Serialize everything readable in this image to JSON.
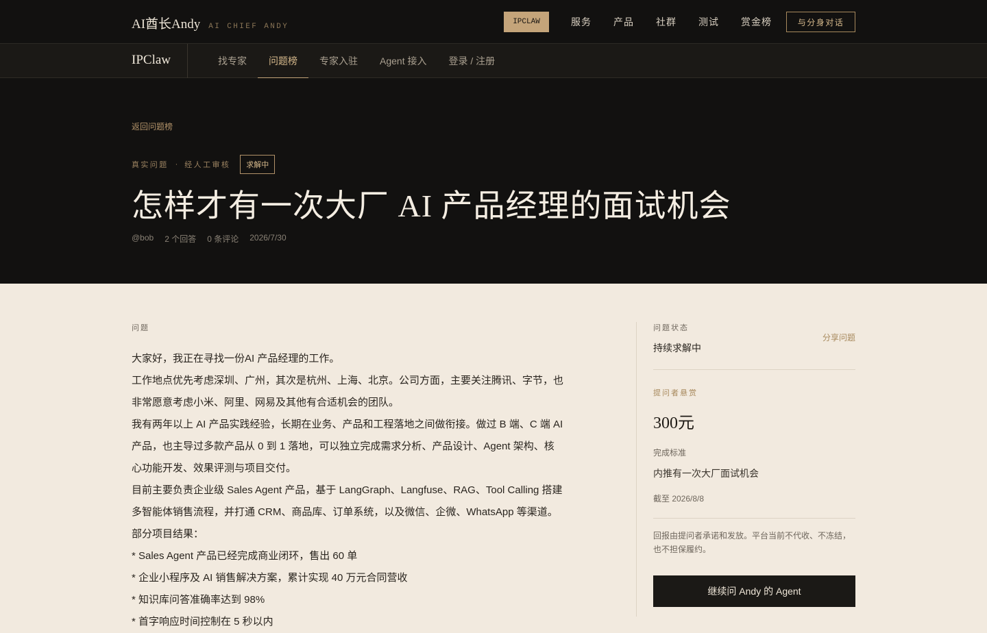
{
  "topbar": {
    "brand_name": "AI酋长Andy",
    "brand_sub": "AI CHIEF ANDY",
    "ipclaw_label": "IPCLAW",
    "nav": [
      "服务",
      "产品",
      "社群",
      "测试",
      "赏金榜"
    ],
    "cta_label": "与分身对话"
  },
  "subbar": {
    "brand": "IPClaw",
    "tabs": [
      {
        "label": "找专家",
        "active": false
      },
      {
        "label": "问题榜",
        "active": true
      },
      {
        "label": "专家入驻",
        "active": false
      },
      {
        "label": "Agent 接入",
        "active": false
      },
      {
        "label": "登录 / 注册",
        "active": false
      }
    ]
  },
  "hero": {
    "back_link": "返回问题榜",
    "tag_real": "真实问题",
    "tag_dot": "·",
    "tag_review": "经人工审核",
    "badge": "求解中",
    "title": "怎样才有一次大厂 AI 产品经理的面试机会",
    "author": "@bob",
    "answers": "2 个回答",
    "comments": "0 条评论",
    "date": "2026/7/30"
  },
  "main": {
    "section_label": "问题",
    "paragraphs": [
      "大家好，我正在寻找一份AI 产品经理的工作。",
      "工作地点优先考虑深圳、广州，其次是杭州、上海、北京。公司方面，主要关注腾讯、字节，也\n非常愿意考虑小米、阿里、网易及其他有合适机会的团队。",
      "我有两年以上 AI 产品实践经验，长期在业务、产品和工程落地之间做衔接。做过 B 端、C 端 AI\n产品，也主导过多款产品从 0 到 1 落地，可以独立完成需求分析、产品设计、Agent 架构、核\n心功能开发、效果评测与项目交付。",
      "目前主要负责企业级 Sales Agent 产品，基于 LangGraph、Langfuse、RAG、Tool Calling 搭建\n多智能体销售流程，并打通 CRM、商品库、订单系统，以及微信、企微、WhatsApp 等渠道。",
      "部分项目结果：",
      "* Sales Agent 产品已经完成商业闭环，售出 60 单",
      "* 企业小程序及 AI 销售解决方案，累计实现 40 万元合同营收",
      "* 知识库问答准确率达到 98%",
      "* 首字响应时间控制在 5 秒以内"
    ]
  },
  "side": {
    "status_label": "问题状态",
    "status_value": "持续求解中",
    "share_label": "分享问题",
    "reward_label": "提问者悬赏",
    "reward_value": "300元",
    "criteria_label": "完成标准",
    "criteria_value": "内推有一次大厂面试机会",
    "deadline": "截至 2026/8/8",
    "notice": "回报由提问者承诺和发放。平台当前不代收、不冻结，\n也不担保履约。",
    "cta_label": "继续问 Andy 的 Agent"
  }
}
